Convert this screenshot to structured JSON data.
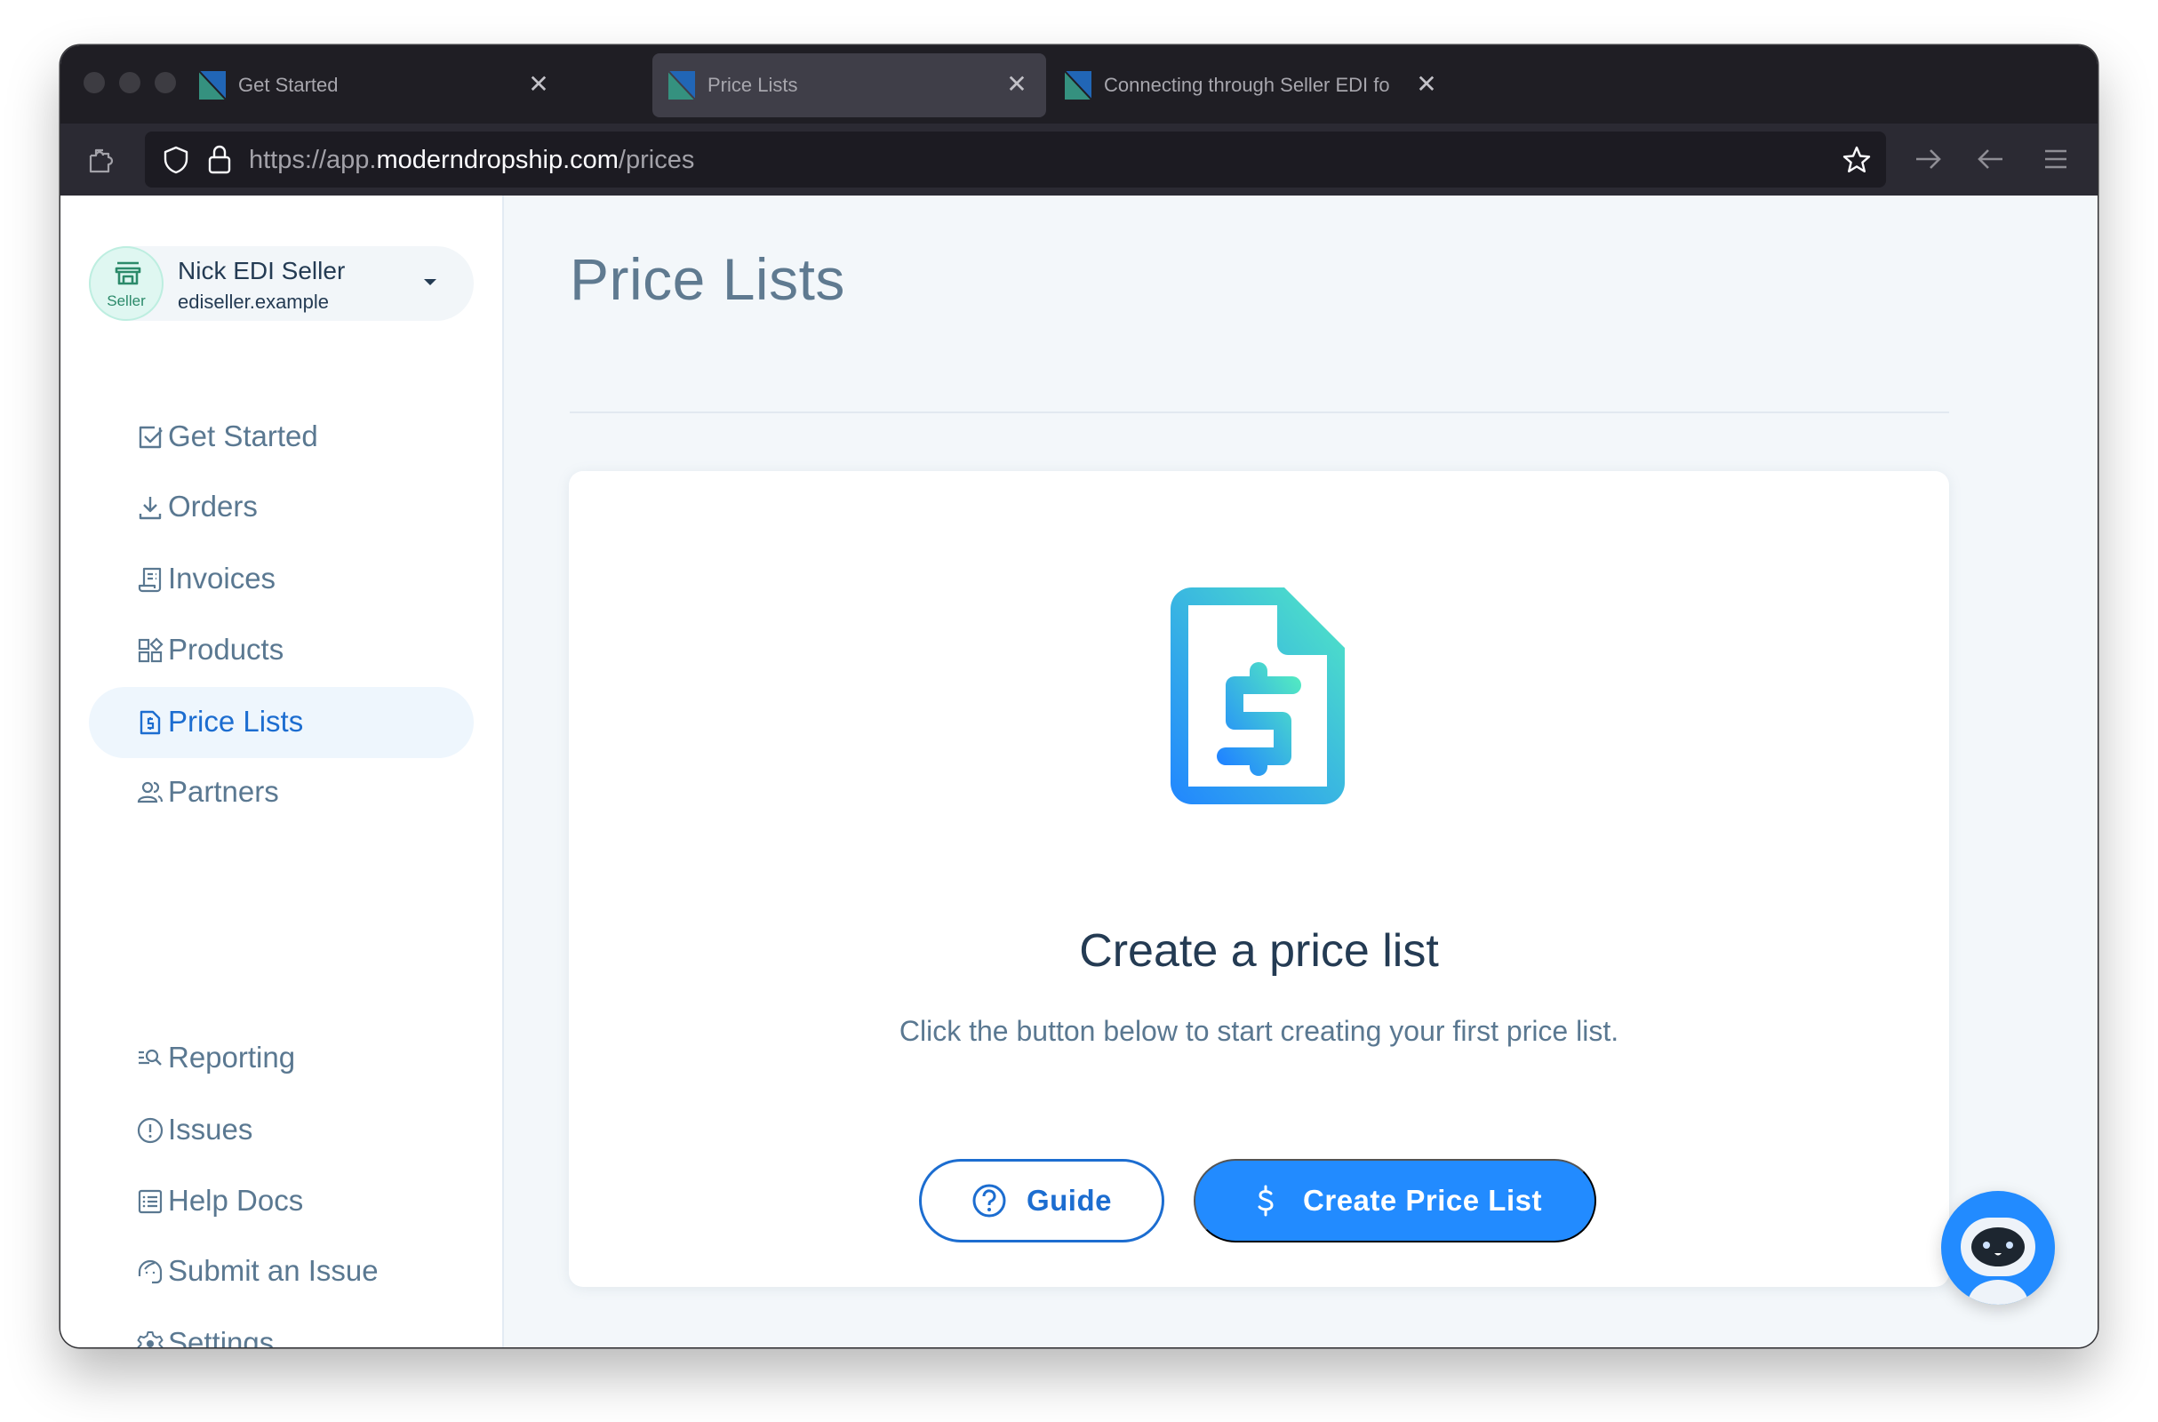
{
  "browser": {
    "tabs": [
      {
        "title": "Get Started",
        "active": false
      },
      {
        "title": "Price Lists",
        "active": true
      },
      {
        "title": "Connecting through Seller EDI fo",
        "active": false
      }
    ],
    "url": {
      "prefix": "https://app.",
      "domain": "moderndropship.com",
      "path": "/prices"
    }
  },
  "account": {
    "badge_label": "Seller",
    "name": "Nick EDI Seller",
    "domain": "ediseller.example"
  },
  "sidebar": {
    "items": [
      {
        "label": "Get Started",
        "icon": "checkbox-icon"
      },
      {
        "label": "Orders",
        "icon": "download-icon"
      },
      {
        "label": "Invoices",
        "icon": "receipt-icon"
      },
      {
        "label": "Products",
        "icon": "shapes-icon"
      },
      {
        "label": "Price Lists",
        "icon": "price-file-icon",
        "active": true
      },
      {
        "label": "Partners",
        "icon": "users-icon"
      }
    ],
    "bottom_items": [
      {
        "label": "Reporting",
        "icon": "report-search-icon"
      },
      {
        "label": "Issues",
        "icon": "alert-circle-icon"
      },
      {
        "label": "Help Docs",
        "icon": "list-doc-icon"
      },
      {
        "label": "Submit an Issue",
        "icon": "support-agent-icon"
      },
      {
        "label": "Settings",
        "icon": "gear-icon"
      }
    ]
  },
  "main": {
    "title": "Price Lists",
    "empty_state": {
      "title": "Create a price list",
      "description": "Click the button below to start creating your first price list.",
      "guide_button": "Guide",
      "create_button": "Create Price List"
    }
  },
  "colors": {
    "accent": "#228bff",
    "accent_dark": "#1c6dd0",
    "text_muted": "#5a7891",
    "text_dark": "#243b53"
  }
}
